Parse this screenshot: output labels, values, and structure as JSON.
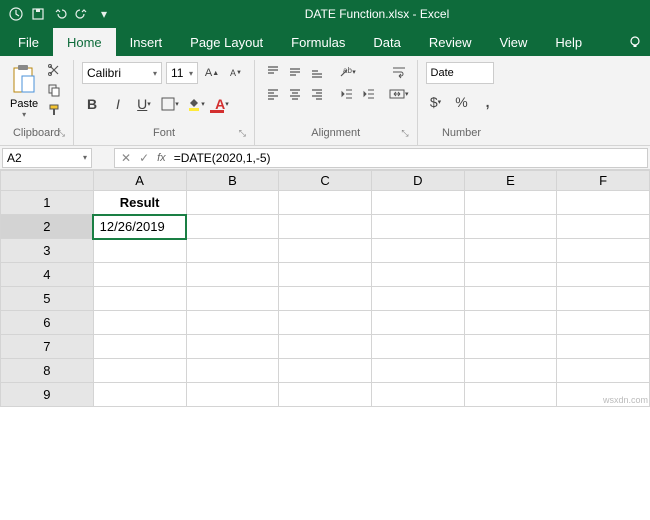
{
  "titlebar": {
    "title": "DATE Function.xlsx - Excel",
    "qat": {
      "save": "save-icon",
      "undo": "undo-icon",
      "redo": "redo-icon"
    }
  },
  "tabs": {
    "file": "File",
    "home": "Home",
    "insert": "Insert",
    "page_layout": "Page Layout",
    "formulas": "Formulas",
    "data": "Data",
    "review": "Review",
    "view": "View",
    "help": "Help"
  },
  "ribbon": {
    "clipboard": {
      "label": "Clipboard",
      "paste": "Paste"
    },
    "font": {
      "label": "Font",
      "name": "Calibri",
      "size": "11"
    },
    "alignment": {
      "label": "Alignment"
    },
    "number": {
      "label": "Number",
      "format": "Date"
    }
  },
  "namebox": {
    "cell_ref": "A2"
  },
  "formula_bar": {
    "formula": "=DATE(2020,1,-5)"
  },
  "grid": {
    "columns": [
      "A",
      "B",
      "C",
      "D",
      "E",
      "F"
    ],
    "rows": [
      "1",
      "2",
      "3",
      "4",
      "5",
      "6",
      "7",
      "8",
      "9"
    ],
    "cells": {
      "A1": "Result",
      "A2": "12/26/2019"
    }
  },
  "watermark": "wsxdn.com"
}
